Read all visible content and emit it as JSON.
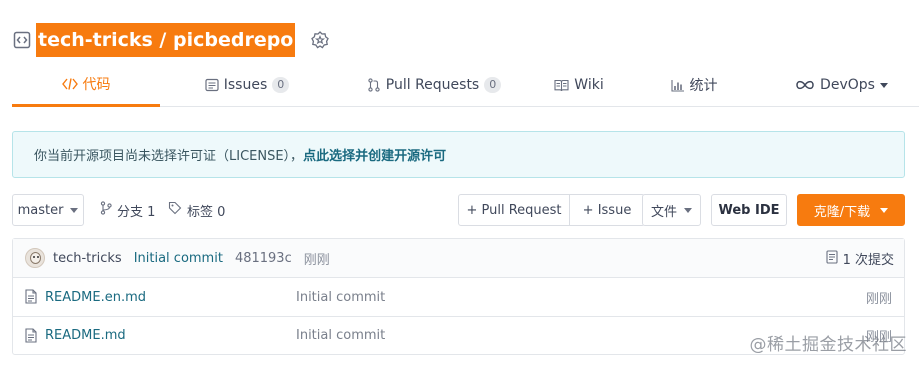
{
  "repo": {
    "title": "tech-tricks / picbedrepo"
  },
  "tabs": [
    {
      "label": "代码",
      "count": null
    },
    {
      "label": "Issues",
      "count": "0"
    },
    {
      "label": "Pull Requests",
      "count": "0"
    },
    {
      "label": "Wiki",
      "count": null
    },
    {
      "label": "统计",
      "count": null
    },
    {
      "label": "DevOps",
      "count": null
    }
  ],
  "notice": {
    "text": "你当前开源项目尚未选择许可证（LICENSE），",
    "link": "点此选择并创建开源许可"
  },
  "toolbar": {
    "branch": "master",
    "branches_label": "分支 1",
    "tags_label": "标签 0",
    "pull_request": "+ Pull Request",
    "issue": "+ Issue",
    "files": "文件",
    "web_ide": "Web IDE",
    "clone": "克隆/下载"
  },
  "latest_commit": {
    "author": "tech-tricks",
    "message": "Initial commit",
    "sha": "481193c",
    "time": "刚刚",
    "commit_count": "1 次提交"
  },
  "files": [
    {
      "name": "README.en.md",
      "message": "Initial commit",
      "time": "刚刚"
    },
    {
      "name": "README.md",
      "message": "Initial commit",
      "time": "刚刚"
    }
  ],
  "watermark": "@稀土掘金技术社区",
  "colors": {
    "accent": "#f77b0f",
    "link": "#1a6a80",
    "notice_bg": "#eef9fb"
  }
}
